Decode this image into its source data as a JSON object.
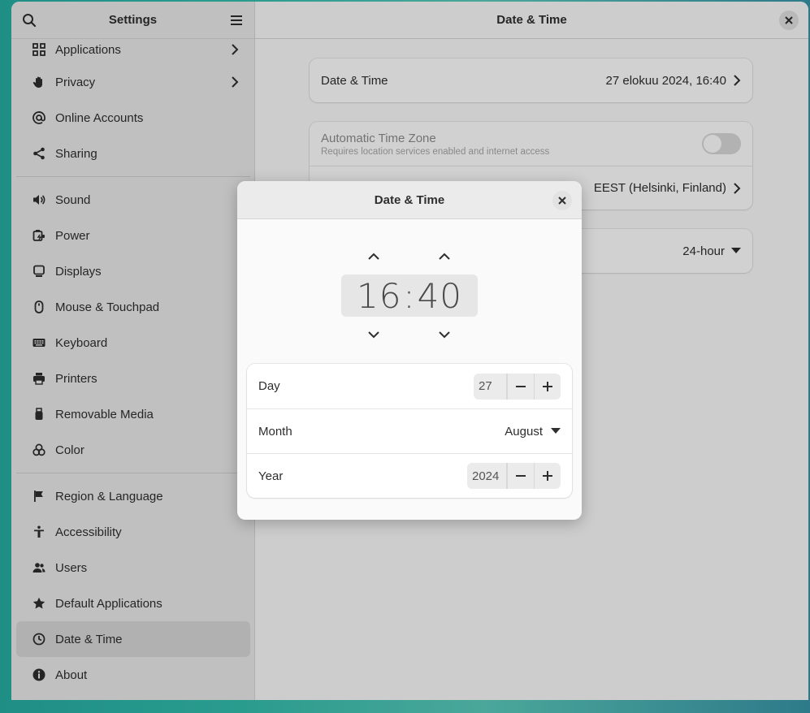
{
  "sidebar": {
    "title": "Settings",
    "items": [
      {
        "label": "Applications",
        "icon": "apps-grid-icon",
        "chevron": true
      },
      {
        "label": "Privacy",
        "icon": "hand-icon",
        "chevron": true
      },
      {
        "label": "Online Accounts",
        "icon": "at-icon"
      },
      {
        "label": "Sharing",
        "icon": "share-icon"
      },
      {
        "label": "Sound",
        "icon": "speaker-icon"
      },
      {
        "label": "Power",
        "icon": "battery-icon"
      },
      {
        "label": "Displays",
        "icon": "monitor-icon"
      },
      {
        "label": "Mouse & Touchpad",
        "icon": "mouse-icon"
      },
      {
        "label": "Keyboard",
        "icon": "keyboard-icon"
      },
      {
        "label": "Printers",
        "icon": "printer-icon"
      },
      {
        "label": "Removable Media",
        "icon": "usb-icon"
      },
      {
        "label": "Color",
        "icon": "color-icon"
      },
      {
        "label": "Region & Language",
        "icon": "flag-icon"
      },
      {
        "label": "Accessibility",
        "icon": "accessibility-icon"
      },
      {
        "label": "Users",
        "icon": "users-icon"
      },
      {
        "label": "Default Applications",
        "icon": "star-icon"
      },
      {
        "label": "Date & Time",
        "icon": "clock-icon",
        "active": true
      },
      {
        "label": "About",
        "icon": "info-icon"
      }
    ]
  },
  "content": {
    "title": "Date & Time",
    "date_time_label": "Date & Time",
    "date_time_value": "27 elokuu 2024, 16:40",
    "auto_tz_label": "Automatic Time Zone",
    "auto_tz_subtitle": "Requires location services enabled and internet access",
    "timezone_value": "EEST (Helsinki, Finland)",
    "time_format_value": "24-hour"
  },
  "dialog": {
    "title": "Date & Time",
    "hours": "16",
    "separator": ":",
    "minutes": "40",
    "day_label": "Day",
    "day_value": "27",
    "month_label": "Month",
    "month_value": "August",
    "year_label": "Year",
    "year_value": "2024"
  },
  "colors": {
    "desktop_bg": "#2a9c8e",
    "sidebar_bg": "#ebebeb",
    "active_item_bg": "#d8d8d8"
  }
}
